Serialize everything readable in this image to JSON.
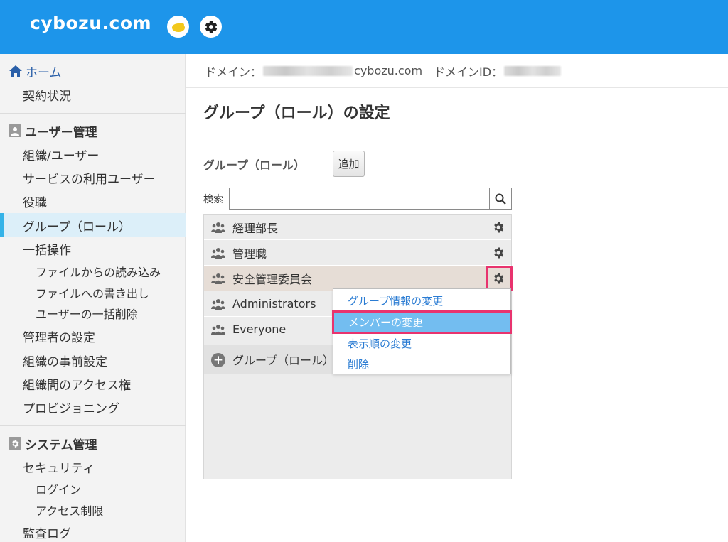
{
  "header": {
    "logo": "cybozu.com",
    "notify_icon": "notification-icon",
    "settings_icon": "gear-icon",
    "bg_color": "#1d95ea"
  },
  "sidebar": {
    "home": "ホーム",
    "contract": "契約状況",
    "user_mgmt_heading": "ユーザー管理",
    "user_items": [
      "組織/ユーザー",
      "サービスの利用ユーザー",
      "役職",
      "グループ（ロール）",
      "一括操作"
    ],
    "bulk_items": [
      "ファイルからの読み込み",
      "ファイルへの書き出し",
      "ユーザーの一括削除"
    ],
    "more_items": [
      "管理者の設定",
      "組織の事前設定",
      "組織間のアクセス権",
      "プロビジョニング"
    ],
    "system_heading": "システム管理",
    "security": "セキュリティ",
    "security_items": [
      "ログイン",
      "アクセス制限"
    ],
    "audit_log": "監査ログ",
    "active_color": "#34b3e8"
  },
  "domain_bar": {
    "domain_label": "ドメイン：",
    "domain_suffix": "cybozu.com",
    "domain_id_label": "ドメインID："
  },
  "main": {
    "title": "グループ（ロール）の設定",
    "group_label": "グループ（ロール）",
    "add_button": "追加",
    "search_label": "検索",
    "search_value": "",
    "groups": [
      "経理部長",
      "管理職",
      "安全管理委員会",
      "Administrators",
      "Everyone"
    ],
    "add_group_row": "グループ（ロール）"
  },
  "context_menu": {
    "items": [
      "グループ情報の変更",
      "メンバーの変更",
      "表示順の変更",
      "削除"
    ],
    "selected_index": 1,
    "highlight_color": "#e8336e"
  }
}
